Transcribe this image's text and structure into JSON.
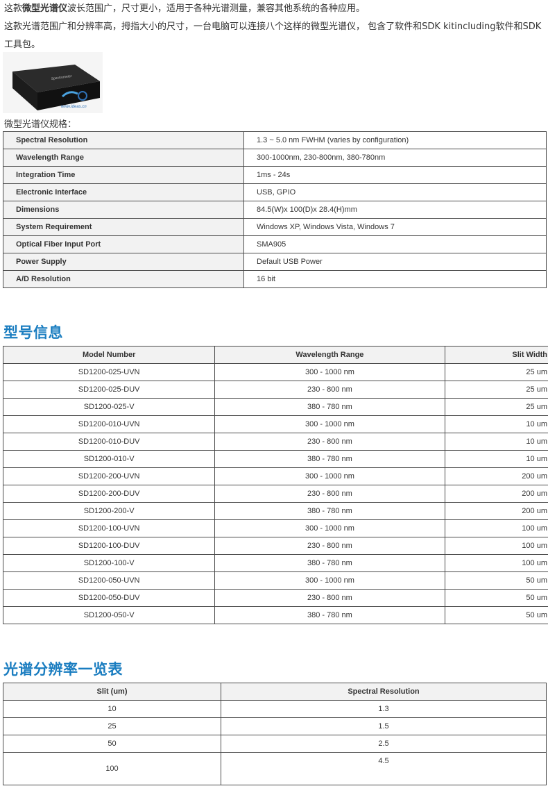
{
  "intro": {
    "line1_pre": "这款",
    "line1_bold": "微型光谱仪",
    "line1_post": "波长范围广，尺寸更小，适用于各种光谱测量，兼容其他系统的各种应用。",
    "line2": "这款光谱范围广和分辨率高，拇指大小的尺寸，一台电脑可以连接八个这样的微型光谱仪， 包含了软件和SDK kitincluding软件和SDK工具包。"
  },
  "photo": {
    "device_label": "Spectrometer",
    "watermark": "www.ideas.cn"
  },
  "spec_caption": "微型光谱仪规格：",
  "specs": [
    {
      "key": "Spectral Resolution",
      "value": "1.3 ~ 5.0 nm FWHM (varies by configuration)"
    },
    {
      "key": "Wavelength Range",
      "value": "300-1000nm, 230-800nm, 380-780nm"
    },
    {
      "key": "Integration Time",
      "value": "1ms - 24s"
    },
    {
      "key": "Electronic Interface",
      "value": "USB, GPIO"
    },
    {
      "key": "Dimensions",
      "value": "84.5(W)x 100(D)x 28.4(H)mm"
    },
    {
      "key": "System Requirement",
      "value": "Windows XP, Windows Vista, Windows 7"
    },
    {
      "key": "Optical Fiber Input Port",
      "value": "SMA905"
    },
    {
      "key": "Power Supply",
      "value": "Default USB Power"
    },
    {
      "key": "A/D Resolution",
      "value": "16 bit"
    }
  ],
  "models_heading": "型号信息",
  "models": {
    "headers": [
      "Model Number",
      "Wavelength Range",
      "Slit Width"
    ],
    "rows": [
      [
        "SD1200-025-UVN",
        "300 - 1000 nm",
        "25 um"
      ],
      [
        "SD1200-025-DUV",
        "230 - 800 nm",
        "25 um"
      ],
      [
        "SD1200-025-V",
        "380 - 780 nm",
        "25 um"
      ],
      [
        "SD1200-010-UVN",
        "300 - 1000 nm",
        "10 um"
      ],
      [
        "SD1200-010-DUV",
        "230 - 800 nm",
        "10 um"
      ],
      [
        "SD1200-010-V",
        "380 - 780 nm",
        "10 um"
      ],
      [
        "SD1200-200-UVN",
        "300 - 1000 nm",
        "200 um"
      ],
      [
        "SD1200-200-DUV",
        "230 - 800 nm",
        "200 um"
      ],
      [
        "SD1200-200-V",
        "380 - 780 nm",
        "200 um"
      ],
      [
        "SD1200-100-UVN",
        "300 - 1000 nm",
        "100 um"
      ],
      [
        "SD1200-100-DUV",
        "230 - 800 nm",
        "100 um"
      ],
      [
        "SD1200-100-V",
        "380 - 780 nm",
        "100 um"
      ],
      [
        "SD1200-050-UVN",
        "300 - 1000 nm",
        "50 um"
      ],
      [
        "SD1200-050-DUV",
        "230 - 800 nm",
        "50 um"
      ],
      [
        "SD1200-050-V",
        "380 - 780 nm",
        "50 um"
      ]
    ]
  },
  "resolution_heading": "光谱分辨率一览表",
  "resolution": {
    "headers": [
      "Slit (um)",
      "Spectral Resolution"
    ],
    "rows": [
      [
        "10",
        "1.3"
      ],
      [
        "25",
        "1.5"
      ],
      [
        "50",
        "2.5"
      ],
      [
        "100",
        "4.5"
      ]
    ]
  },
  "colors": {
    "heading": "#1a7dc0",
    "border": "#4a4a4a",
    "header_bg": "#f2f2f2"
  }
}
